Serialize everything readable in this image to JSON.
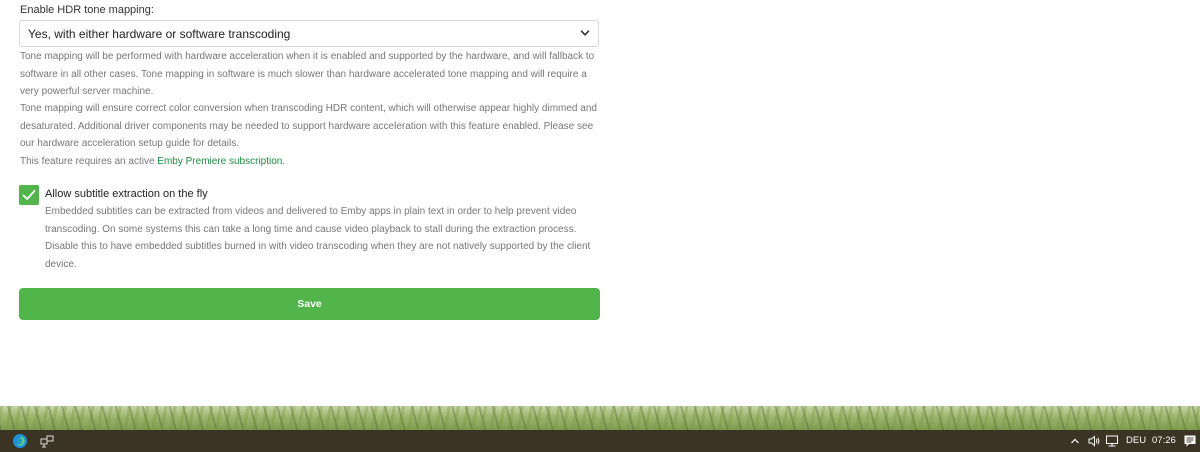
{
  "hdr": {
    "label": "Enable HDR tone mapping:",
    "selected": "Yes, with either hardware or software transcoding",
    "help1": "Tone mapping will be performed with hardware acceleration when it is enabled and supported by the hardware, and will fallback to software in all other cases. Tone mapping in software is much slower than hardware accelerated tone mapping and will require a very powerful server machine.",
    "help2": "Tone mapping will ensure correct color conversion when transcoding HDR content, which will otherwise appear highly dimmed and desaturated. Additional driver components may be needed to support hardware acceleration with this feature enabled. Please see our hardware acceleration setup guide for details.",
    "premiere_prefix": "This feature requires an active ",
    "premiere_link": "Emby Premiere subscription",
    "premiere_suffix": "."
  },
  "subtitle": {
    "checked": true,
    "label": "Allow subtitle extraction on the fly",
    "help": "Embedded subtitles can be extracted from videos and delivered to Emby apps in plain text in order to help prevent video transcoding. On some systems this can take a long time and cause video playback to stall during the extraction process. Disable this to have embedded subtitles burned in with video transcoding when they are not natively supported by the client device."
  },
  "save_label": "Save",
  "taskbar": {
    "language": "DEU",
    "time": "07:26",
    "icons": [
      "edge-icon",
      "network-app-icon",
      "chevron-up-icon",
      "speaker-icon",
      "network-icon",
      "notification-icon"
    ]
  },
  "colors": {
    "accent": "#52b54b",
    "link": "#1e8a3e",
    "taskbar": "#3b3324"
  }
}
